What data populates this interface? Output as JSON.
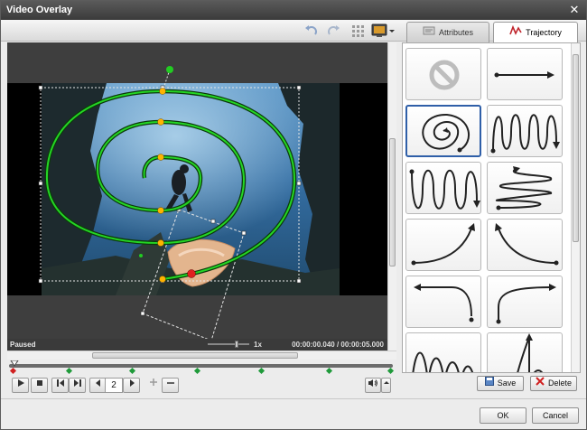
{
  "window": {
    "title": "Video Overlay",
    "close_glyph": "✕"
  },
  "toolbar": {
    "icons": [
      "undo-icon",
      "redo-icon",
      "grid-icon",
      "preview-monitor-icon",
      "dropdown-arrow-icon"
    ]
  },
  "tabs": [
    {
      "label": "Attributes",
      "icon": "attributes-icon",
      "active": false
    },
    {
      "label": "Trajectory",
      "icon": "trajectory-icon",
      "active": true
    }
  ],
  "player": {
    "status": "Paused",
    "zoom": "1x",
    "time": "00:00:00.040 / 00:00:05.000",
    "frame_value": "2"
  },
  "trajectory_presets": [
    {
      "id": "none",
      "icon": "no-trajectory-icon"
    },
    {
      "id": "straight-line",
      "icon": "straight-arrow-icon"
    },
    {
      "id": "spiral",
      "icon": "spiral-icon",
      "selected": true
    },
    {
      "id": "vertical-wave",
      "icon": "vertical-wave-icon"
    },
    {
      "id": "vertical-wave-down",
      "icon": "wave-down-icon"
    },
    {
      "id": "horizontal-zigzag",
      "icon": "horizontal-zigzag-icon"
    },
    {
      "id": "curve-up-right",
      "icon": "curve-up-right-icon"
    },
    {
      "id": "curve-up-left",
      "icon": "curve-up-left-icon"
    },
    {
      "id": "curve-left-down",
      "icon": "curve-left-down-icon"
    },
    {
      "id": "curve-down-up",
      "icon": "curve-down-up-icon"
    },
    {
      "id": "bounce-left",
      "icon": "bounce-icon"
    },
    {
      "id": "bounce-arrow",
      "icon": "bounce-arrow-icon"
    }
  ],
  "buttons": {
    "save": "Save",
    "delete": "Delete",
    "ok": "OK",
    "cancel": "Cancel"
  },
  "colors": {
    "trajectory_line": "#1fd11f",
    "keyframe": "#ffb300",
    "start_point": "#22cc22",
    "end_point": "#e02020",
    "selected_tile": "#2f5fa8"
  }
}
